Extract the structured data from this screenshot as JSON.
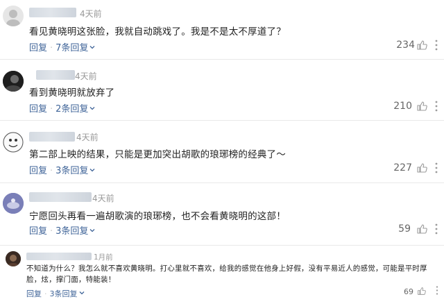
{
  "comments": [
    {
      "time": "4天前",
      "text": "看见黄晓明这张脸，我就自动跳戏了。我是不是太不厚道了？",
      "reply_label": "回复",
      "replies_label": "7条回复",
      "likes": "234",
      "avatar": "grey-default-avatar"
    },
    {
      "time": "4天前",
      "text": "看到黄晓明就放弃了",
      "reply_label": "回复",
      "replies_label": "2条回复",
      "likes": "210",
      "avatar": "dark-photo-avatar"
    },
    {
      "time": "4天前",
      "text": "第二部上映的结果，只能是更加突出胡歌的琅琊榜的经典了～",
      "reply_label": "回复",
      "replies_label": "3条回复",
      "likes": "227",
      "avatar": "cartoon-face-avatar"
    },
    {
      "time": "4天前",
      "text": "宁愿回头再看一遍胡歌演的琅琊榜，也不会看黄晓明的这部！",
      "reply_label": "回复",
      "replies_label": "3条回复",
      "likes": "59",
      "avatar": "purple-photo-avatar"
    },
    {
      "time": "1月前",
      "text": "不知道为什么？我怎么就不喜欢黄晓明。打心里就不喜欢，给我的感觉在他身上好假，没有平易近人的感觉，可能是平时厚脸，炫，撑门面，特能装！",
      "reply_label": "回复",
      "replies_label": "3条回复",
      "likes": "69",
      "avatar": "dark-circle-avatar"
    }
  ],
  "colors": {
    "link": "#406599",
    "text": "#222222",
    "meta": "#999999",
    "divider": "#e8e8e8"
  },
  "icons": {
    "like": "thumb-up-icon",
    "more": "more-dots-icon",
    "expand": "chevron-down-icon"
  }
}
